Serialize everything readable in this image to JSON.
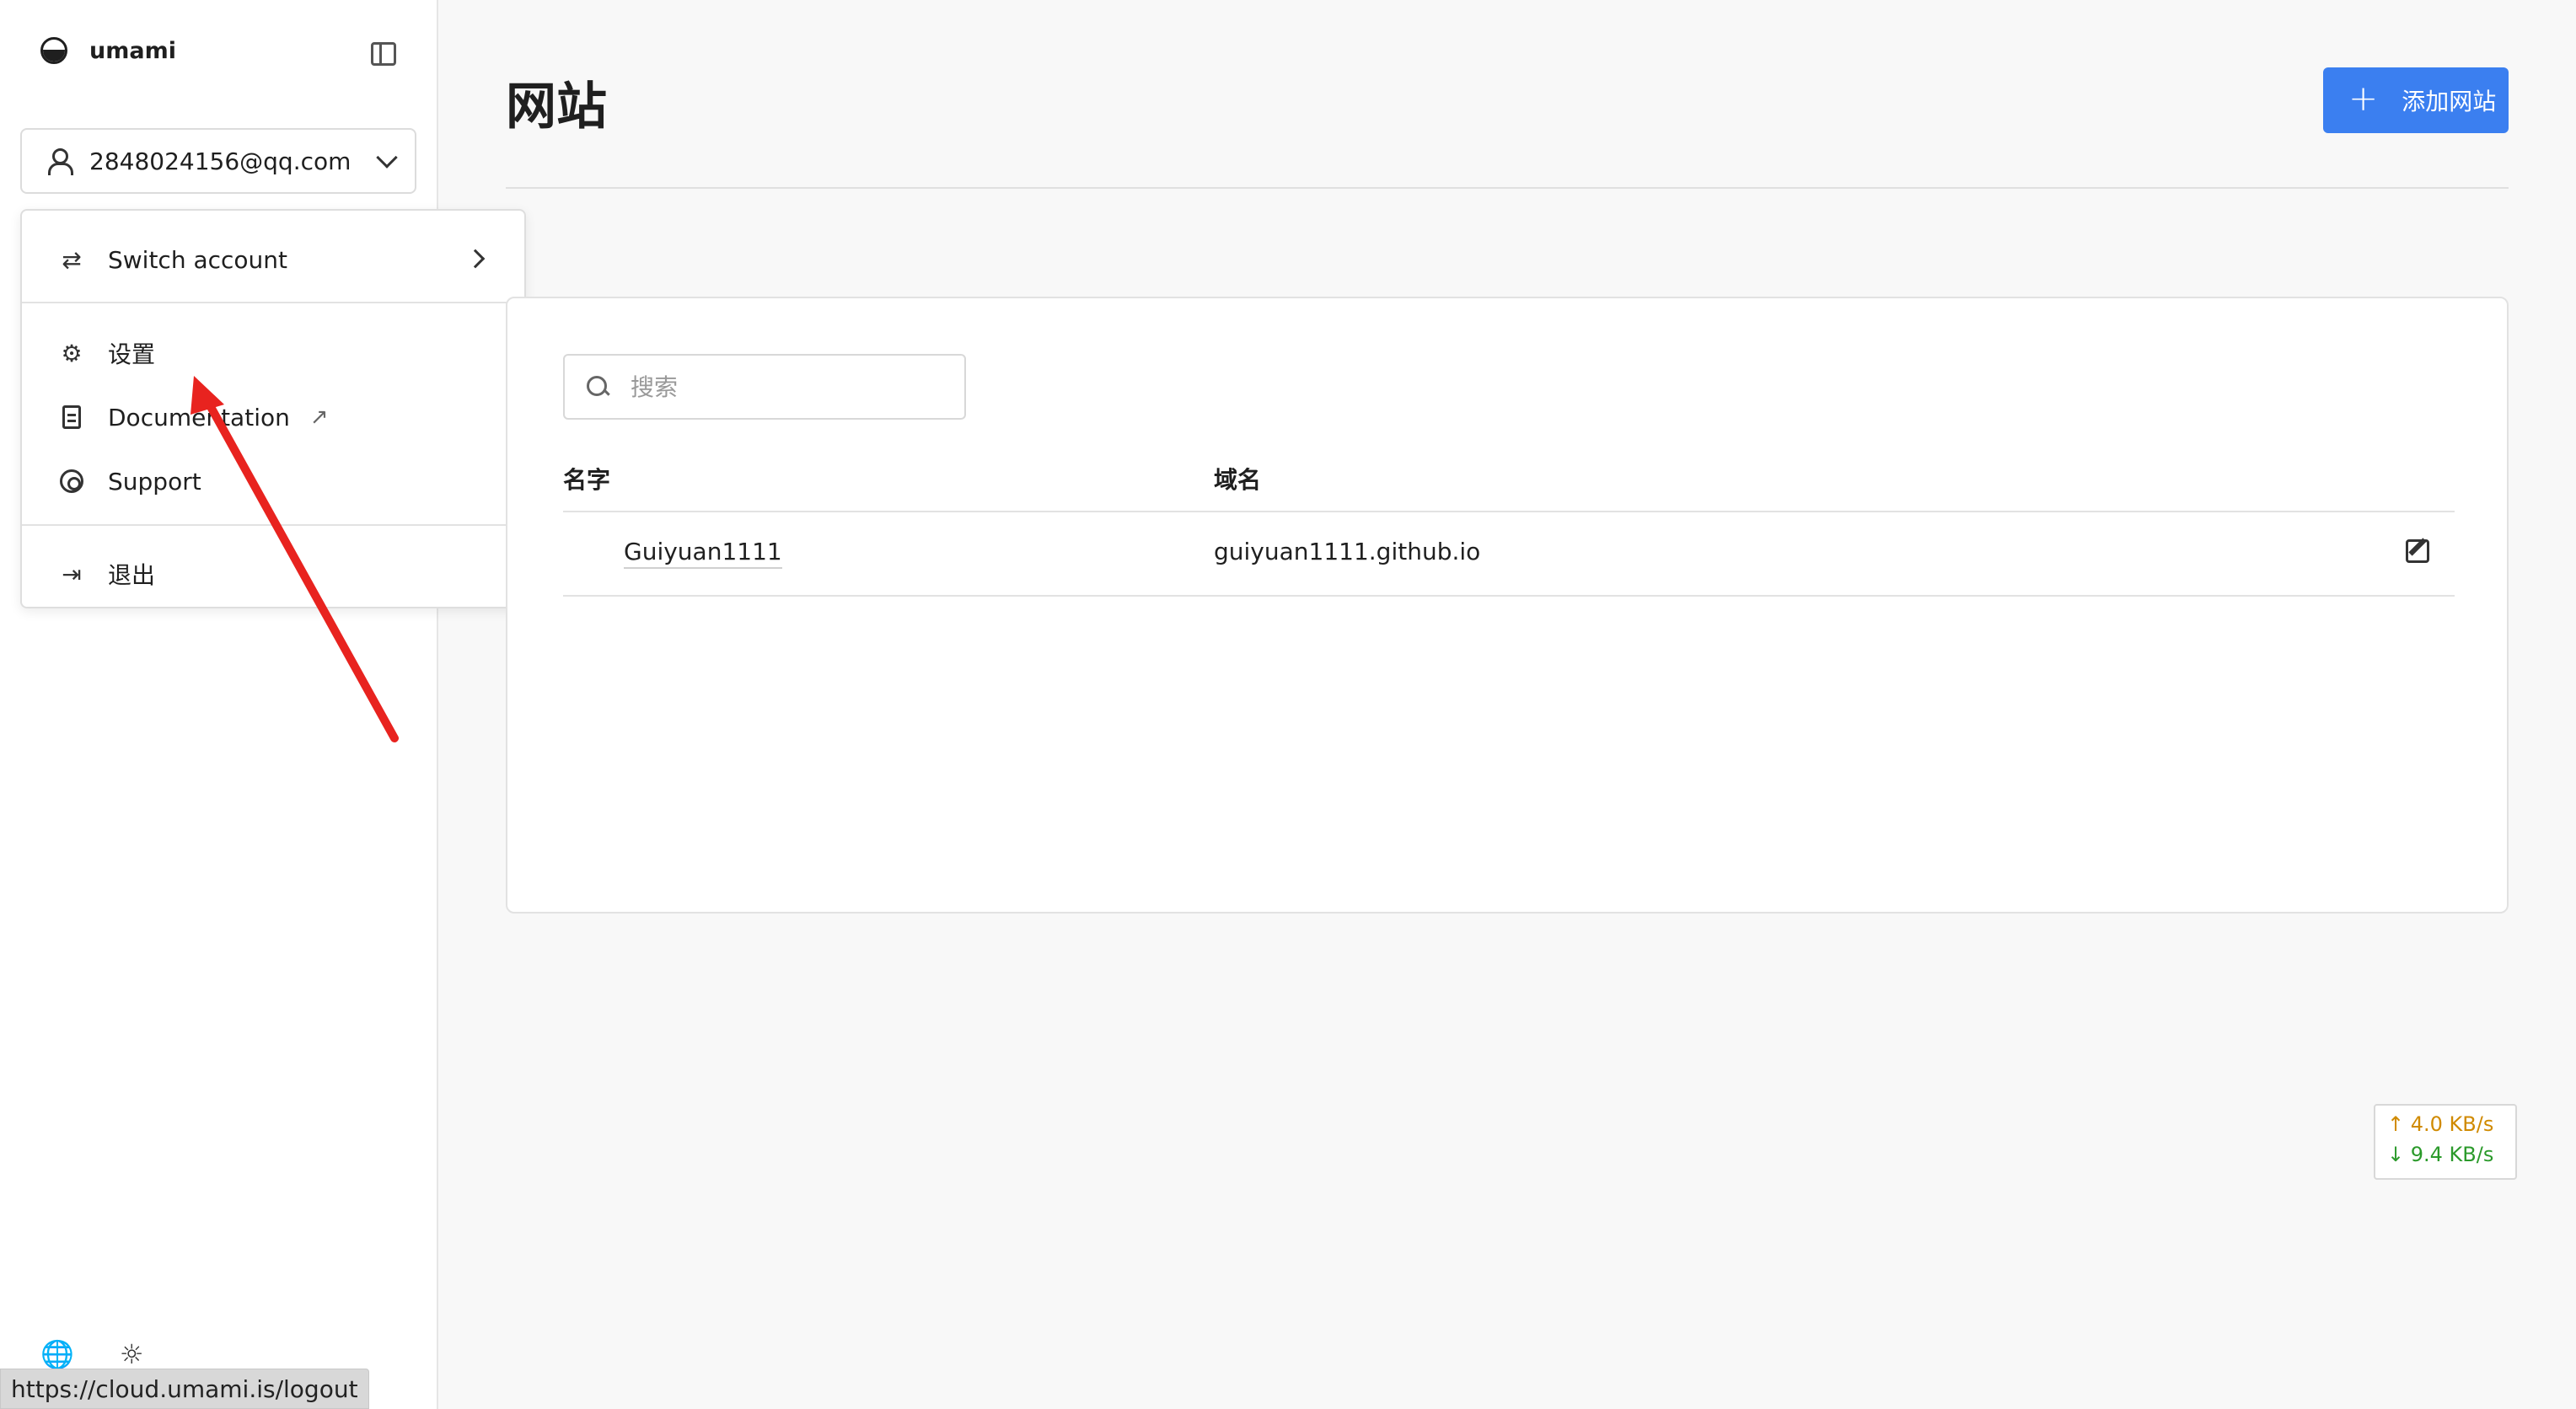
{
  "app": {
    "name": "umami"
  },
  "account": {
    "email": "2848024156@qq.com"
  },
  "menu": {
    "switch_account": "Switch account",
    "settings": "设置",
    "documentation": "Documentation",
    "support": "Support",
    "logout": "退出"
  },
  "page": {
    "title": "网站",
    "add_button": "添加网站"
  },
  "search": {
    "placeholder": "搜索",
    "value": ""
  },
  "table": {
    "headers": [
      "名字",
      "域名"
    ],
    "rows": [
      {
        "name": "Guiyuan1111",
        "domain": "guiyuan1111.github.io"
      }
    ]
  },
  "netspeed": {
    "up": "↑ 4.0 KB/s",
    "down": "↓ 9.4 KB/s"
  },
  "status_bar": {
    "url": "https://cloud.umami.is/logout"
  },
  "colors": {
    "primary": "#3b7ff0",
    "annotation_arrow": "#e8231f",
    "upload": "#d08a00",
    "download": "#2b9a2b"
  },
  "icons": [
    "umami-logo-icon",
    "sidebar-toggle-icon",
    "user-icon",
    "chevron-down-icon",
    "switch-icon",
    "chevron-right-icon",
    "gear-icon",
    "document-icon",
    "external-link-icon",
    "lifebuoy-icon",
    "logout-icon",
    "plus-icon",
    "search-icon",
    "edit-icon",
    "globe-icon",
    "sun-icon"
  ]
}
